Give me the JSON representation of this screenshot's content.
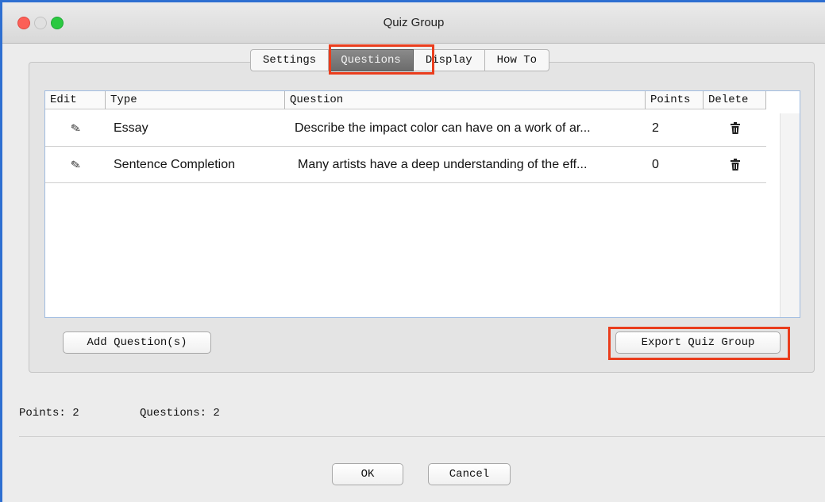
{
  "window": {
    "title": "Quiz Group"
  },
  "tabs": [
    {
      "label": "Settings",
      "active": false
    },
    {
      "label": "Questions",
      "active": true
    },
    {
      "label": "Display",
      "active": false
    },
    {
      "label": "How To",
      "active": false
    }
  ],
  "table": {
    "columns": [
      "Edit",
      "Type",
      "Question",
      "Points",
      "Delete"
    ],
    "rows": [
      {
        "type": "Essay",
        "question": "Describe the impact color can have on a work of ar...",
        "points": "2"
      },
      {
        "type": "Sentence Completion",
        "question": "Many artists have a deep understanding of the eff...",
        "points": "0"
      }
    ]
  },
  "buttons": {
    "add_question": "Add Question(s)",
    "export_quiz_group": "Export Quiz Group",
    "ok": "OK",
    "cancel": "Cancel"
  },
  "status": {
    "points": "Points: 2",
    "questions": "Questions: 2"
  },
  "colors": {
    "highlight": "#ea3d1d",
    "window_frame": "#2e6fd1",
    "active_tab": "#7a7a7a"
  },
  "icons": {
    "edit": "pencil-icon",
    "delete": "trash-icon"
  }
}
